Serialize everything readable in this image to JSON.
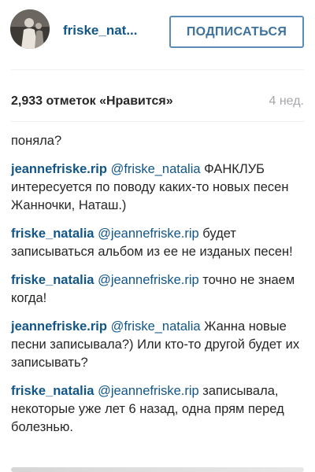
{
  "header": {
    "username": "friske_nat...",
    "follow_label": "ПОДПИСАТЬСЯ"
  },
  "stats": {
    "likes": "2,933 отметок «Нравится»",
    "time": "4 нед."
  },
  "comments": [
    {
      "author": "",
      "mention": "",
      "text": "поняла?"
    },
    {
      "author": "jeannefriske.rip",
      "mention": "@friske_natalia",
      "text": " ФАНКЛУБ интересуется по поводу каких-то новых песен Жанночки, Наташ.)"
    },
    {
      "author": "friske_natalia",
      "mention": "@jeannefriske.rip",
      "text": " будет записываться альбом из ее не изданых песен!"
    },
    {
      "author": "friske_natalia",
      "mention": "@jeannefriske.rip",
      "text": " точно не знаем когда!"
    },
    {
      "author": "jeannefriske.rip",
      "mention": "@friske_natalia",
      "text": " Жанна новые песни записывала?) Или кто-то другой будет их записывать?"
    },
    {
      "author": "friske_natalia",
      "mention": "@jeannefriske.rip",
      "text": " записывала, некоторые уже лет 6 назад, одна прям перед болезнью."
    }
  ],
  "colors": {
    "link": "#125688",
    "button": "#3f729b",
    "muted": "#a5a7aa"
  }
}
